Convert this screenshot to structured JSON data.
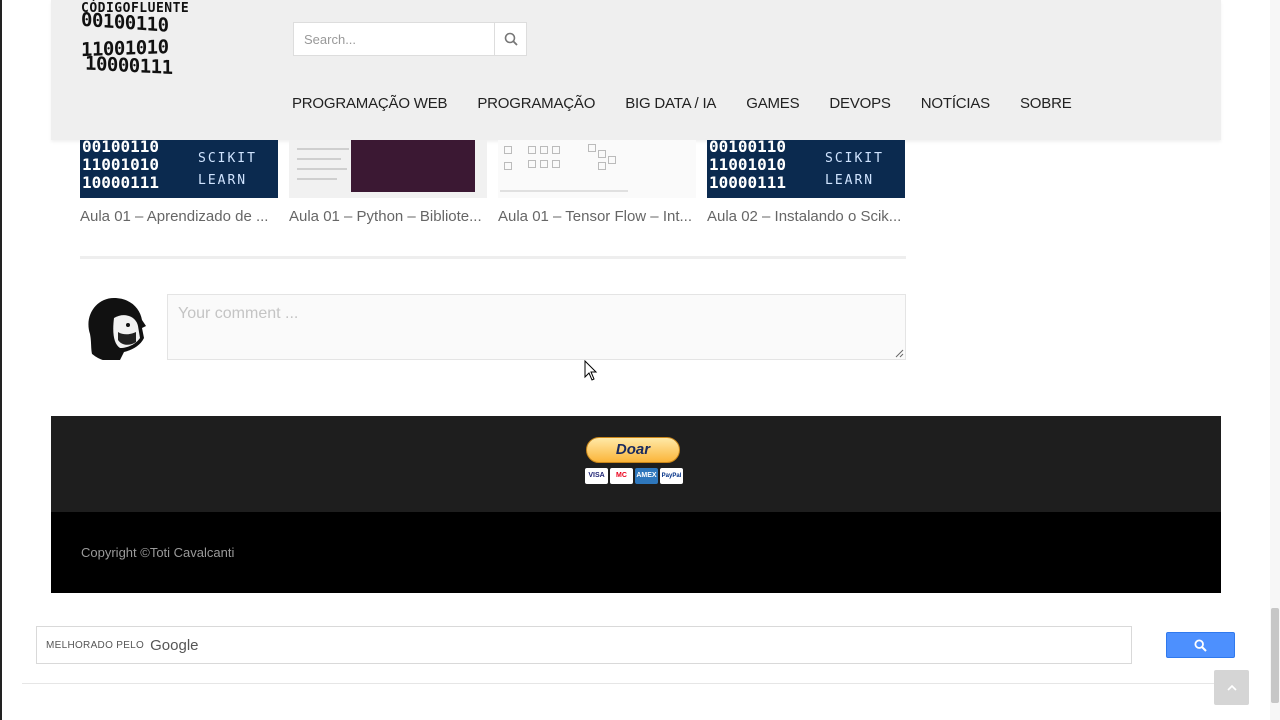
{
  "header": {
    "logo_text": "CÓDIGOFLUENTE",
    "logo_bits": [
      "00100110",
      "11001010",
      "10000111"
    ],
    "search_placeholder": "Search...",
    "search_icon": "search-icon",
    "nav": [
      "PROGRAMAÇÃO WEB",
      "PROGRAMAÇÃO",
      "BIG DATA / IA",
      "GAMES",
      "DEVOPS",
      "NOTÍCIAS",
      "SOBRE"
    ]
  },
  "related_posts": [
    {
      "title": "Aula 01 – Aprendizado de ...",
      "thumb": "scikit-learn"
    },
    {
      "title": "Aula 01 – Python – Bibliote...",
      "thumb": "terminal"
    },
    {
      "title": "Aula 01 – Tensor Flow – Int...",
      "thumb": "matrices"
    },
    {
      "title": "Aula 02 – Instalando o Scik...",
      "thumb": "scikit-learn"
    }
  ],
  "thumb_text": {
    "bits": [
      "00100110",
      "11001010",
      "10000111"
    ],
    "scikit": "SCIKIT",
    "learn": "LEARN"
  },
  "comment": {
    "placeholder": "Your comment ..."
  },
  "footer": {
    "donate_label": "Doar",
    "cards": [
      "VISA",
      "MC",
      "AMEX",
      "PayPal"
    ],
    "copyright": "Copyright ©Toti Cavalcanti"
  },
  "google_search": {
    "enhanced_by": "MELHORADO PELO",
    "google": "Google",
    "button_icon": "search-icon"
  },
  "colors": {
    "header_bg": "#efefef",
    "donate_bg": "#1e1e1e",
    "copyright_bg": "#000000",
    "search_button": "#4d90fe"
  }
}
